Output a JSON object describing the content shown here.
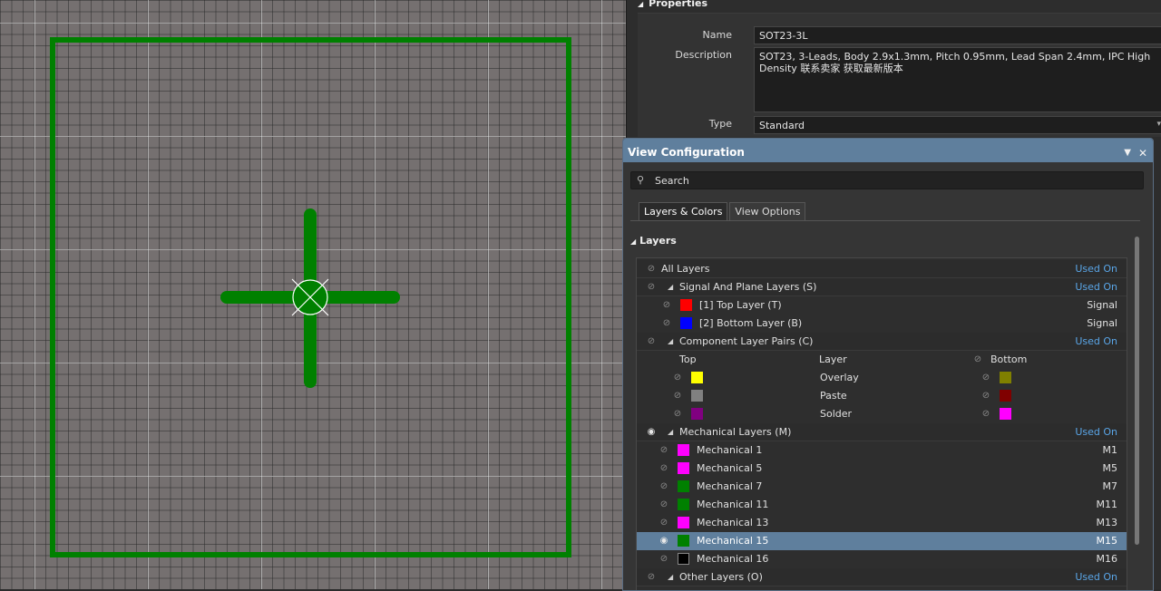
{
  "properties": {
    "header": "Properties",
    "name_label": "Name",
    "name_value": "SOT23-3L",
    "desc_label": "Description",
    "desc_value": "SOT23, 3-Leads, Body 2.9x1.3mm, Pitch 0.95mm, Lead Span 2.4mm, IPC High Density 联系卖家 获取最新版本",
    "type_label": "Type",
    "type_value": "Standard"
  },
  "view_config": {
    "title": "View Configuration",
    "search_placeholder": "Search",
    "tabs": [
      "Layers & Colors",
      "View Options"
    ],
    "section": "Layers",
    "all_layers": {
      "label": "All Layers",
      "status": "Used On"
    },
    "signal": {
      "label": "Signal And Plane Layers (S)",
      "status": "Used On",
      "items": [
        {
          "label": "[1] Top Layer (T)",
          "right": "Signal",
          "color": "#ff0000"
        },
        {
          "label": "[2] Bottom Layer (B)",
          "right": "Signal",
          "color": "#0000ff"
        }
      ]
    },
    "pairs": {
      "label": "Component Layer Pairs (C)",
      "status": "Used On",
      "col_top": "Top",
      "col_layer": "Layer",
      "col_bottom": "Bottom",
      "items": [
        {
          "layer": "Overlay",
          "top_color": "#ffff00",
          "bottom_color": "#808000"
        },
        {
          "layer": "Paste",
          "top_color": "#808080",
          "bottom_color": "#800000"
        },
        {
          "layer": "Solder",
          "top_color": "#800080",
          "bottom_color": "#ff00ff"
        }
      ]
    },
    "mechanical": {
      "label": "Mechanical Layers (M)",
      "status": "Used On",
      "items": [
        {
          "label": "Mechanical 1",
          "right": "M1",
          "color": "#ff00ff"
        },
        {
          "label": "Mechanical 5",
          "right": "M5",
          "color": "#ff00ff"
        },
        {
          "label": "Mechanical 7",
          "right": "M7",
          "color": "#008000"
        },
        {
          "label": "Mechanical 11",
          "right": "M11",
          "color": "#008000"
        },
        {
          "label": "Mechanical 13",
          "right": "M13",
          "color": "#ff00ff"
        },
        {
          "label": "Mechanical 15",
          "right": "M15",
          "color": "#008000"
        },
        {
          "label": "Mechanical 16",
          "right": "M16",
          "color": "#000000"
        }
      ]
    },
    "other": {
      "label": "Other Layers (O)",
      "status": "Used On"
    }
  },
  "colors": {
    "outline": "#008000",
    "accent": "#5f7f9d",
    "used_on": "#5aa6e8"
  },
  "icons": [
    "eye-off-icon",
    "eye-icon",
    "search-icon",
    "collapse-triangle-icon",
    "dropdown-icon",
    "close-icon"
  ]
}
